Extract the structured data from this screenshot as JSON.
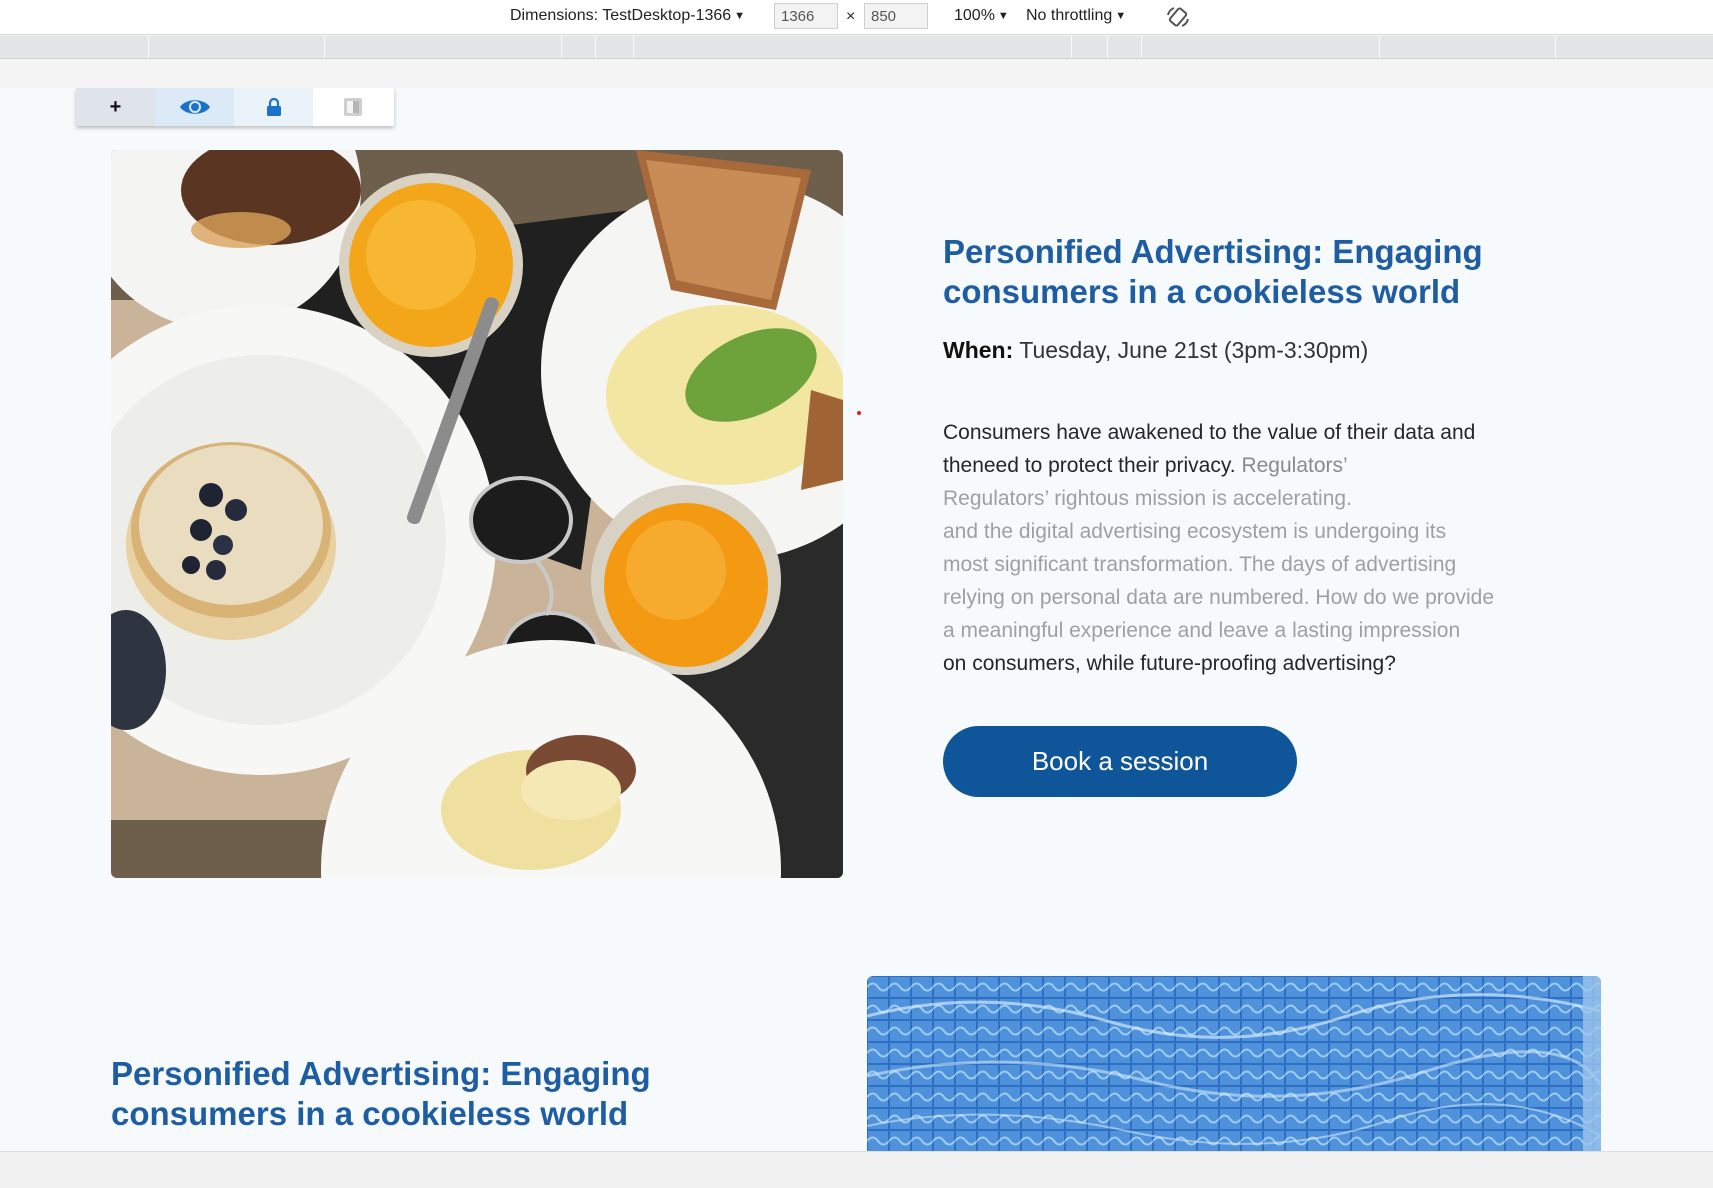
{
  "devtools": {
    "dimensions_label": "Dimensions: TestDesktop-1366",
    "width_value": "1366",
    "times": "×",
    "height_value": "850",
    "zoom": "100%",
    "throttling": "No throttling"
  },
  "editor_tools": {
    "add": "+",
    "view_icon": "eye-icon",
    "lock_icon": "lock-icon",
    "contrast_icon": "contrast-icon"
  },
  "article1": {
    "title": "Personified Advertising: Engaging consumers in a cookieless world",
    "when_label": "When:",
    "when_value": "Tuesday, June 21st (3pm-3:30pm)",
    "desc_main": "Consumers have awakened to the value of their data and theneed to protect their privacy.",
    "desc_tail": "Regulators’",
    "overlay_lines": [
      "Regulators’ rightous mission is accelerating.",
      "and the digital advertising ecosystem is undergoing its",
      "most significant transformation. The days of advertising",
      "relying on personal data are numbered. How do we provide",
      "a meaningful experience and leave a lasting impression",
      "on consumers, while future-proofing advertising?"
    ],
    "cta": "Book a session"
  },
  "article2": {
    "title": "Personified Advertising: Engaging consumers in a cookieless world"
  },
  "colors": {
    "accent": "#1f5da3",
    "button": "#0f559a",
    "page_bg": "#f7fafd"
  }
}
